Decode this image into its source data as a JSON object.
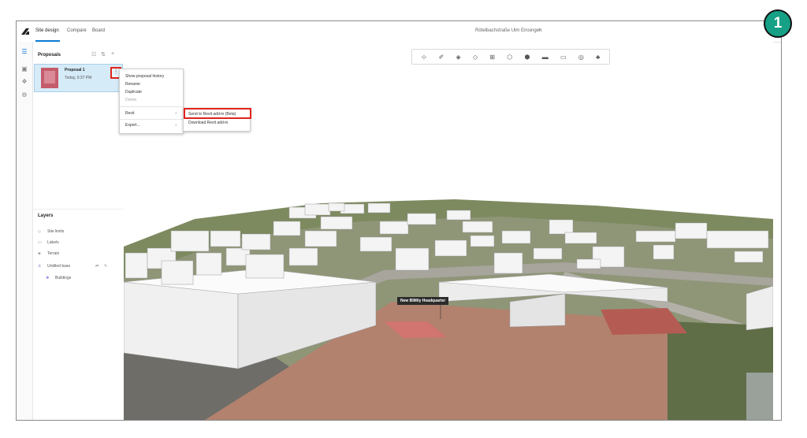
{
  "step_badge": "1",
  "app": {
    "tabs": [
      {
        "label": "Site design",
        "active": true
      },
      {
        "label": "Compare",
        "active": false
      },
      {
        "label": "Board",
        "active": false
      }
    ],
    "document_title": "Rötelbachstraße Ulm Einsingen"
  },
  "proposals": {
    "title": "Proposals",
    "items": [
      {
        "name": "Proposal 1",
        "date": "Today, 5:37 PM",
        "more": "⋮"
      }
    ]
  },
  "context_menu": {
    "items": [
      {
        "label": "Show proposal history",
        "disabled": false
      },
      {
        "label": "Rename",
        "disabled": false
      },
      {
        "label": "Duplicate",
        "disabled": false
      },
      {
        "label": "Delete",
        "disabled": true
      },
      {
        "label": "Revit",
        "submenu": true
      },
      {
        "label": "Export...",
        "submenu": true
      }
    ]
  },
  "revit_submenu": {
    "items": [
      {
        "label": "Send to Revit add-in (Beta)",
        "highlighted": true
      },
      {
        "label": "Download Revit add-in",
        "highlighted": false
      }
    ]
  },
  "layers": {
    "title": "Layers",
    "items": [
      {
        "label": "Site limits",
        "icon": "site-limits-icon"
      },
      {
        "label": "Labels",
        "icon": "label-icon"
      },
      {
        "label": "Terrain",
        "icon": "terrain-icon"
      },
      {
        "label": "Untitled base",
        "icon": "base-icon"
      },
      {
        "label": "Buildings",
        "icon": "buildings-icon"
      }
    ]
  },
  "viewport": {
    "label": "New BIMily Headquarter"
  },
  "colors": {
    "accent": "#0a7bd6",
    "highlight_border": "#e2231a",
    "badge": "#16a085",
    "selected_card": "#d6ebf8",
    "proposal_thumb": "#c55c6b"
  }
}
